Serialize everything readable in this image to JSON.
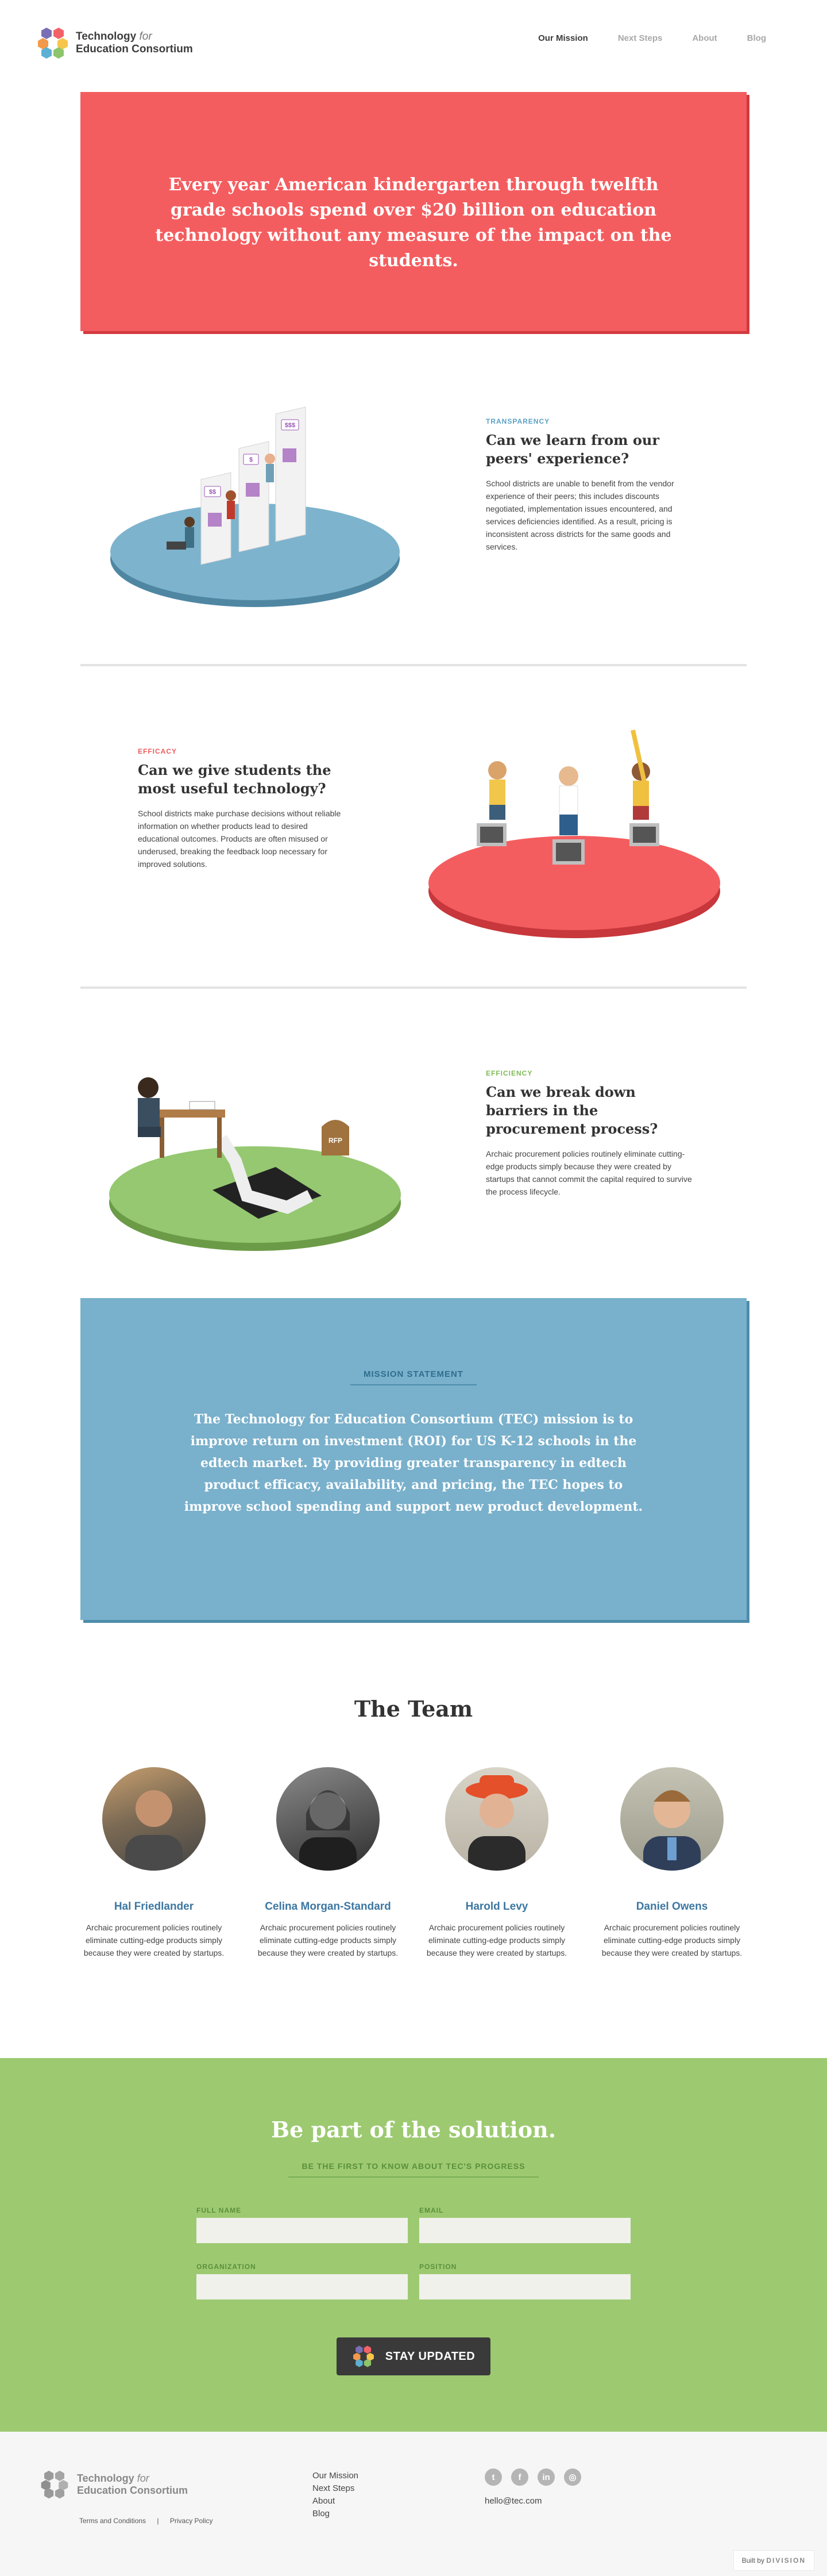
{
  "header": {
    "logo_line1_bold": "Technology",
    "logo_line1_italic": "for",
    "logo_line2": "Education Consortium",
    "nav": [
      "Our Mission",
      "Next Steps",
      "About",
      "Blog"
    ],
    "nav_active": "Our Mission"
  },
  "hero": {
    "text": "Every year American kindergarten through twelfth grade schools spend over $20 billion on education technology without any measure of the impact on the students."
  },
  "features": [
    {
      "kicker": "TRANSPARENCY",
      "kicker_color": "#5aa0c4",
      "title": "Can we learn from our peers' experience?",
      "body": "School districts are unable to benefit from the vendor experience of their peers; this includes discounts negotiated, implementation issues encountered, and services deficiencies identified. As a result, pricing is inconsistent across districts for the same goods and services."
    },
    {
      "kicker": "EFFICACY",
      "kicker_color": "#f05a5c",
      "title": "Can we give students the most useful technology?",
      "body": "School districts make purchase decisions without reliable information on whether products lead to desired educational outcomes. Products are often misused or underused, breaking the feedback loop necessary for improved solutions."
    },
    {
      "kicker": "EFFICIENCY",
      "kicker_color": "#7dbb54",
      "title": "Can we break down barriers in the procurement process?",
      "body": "Archaic procurement policies routinely eliminate cutting-edge products simply because they were created by startups that cannot commit the capital required to survive the process lifecycle."
    }
  ],
  "illustration_labels": {
    "price_1": "$$",
    "price_2": "$",
    "price_3": "$$$",
    "rfp": "RFP"
  },
  "mission": {
    "label": "MISSION STATEMENT",
    "text": "The Technology for Education Consortium (TEC) mission is to improve return on investment (ROI) for US K-12 schools in the edtech market. By providing greater transparency in edtech product efficacy, availability, and pricing, the TEC hopes to improve school spending and support new product development."
  },
  "team": {
    "title": "The Team",
    "members": [
      {
        "name": "Hal Friedlander",
        "bio": "Archaic procurement policies routinely eliminate cutting-edge products simply because they were created by startups."
      },
      {
        "name": "Celina Morgan-Standard",
        "bio": "Archaic procurement policies routinely eliminate cutting-edge products simply because they were created by startups."
      },
      {
        "name": "Harold Levy",
        "bio": "Archaic procurement policies routinely eliminate cutting-edge products simply because they were created by startups."
      },
      {
        "name": "Daniel Owens",
        "bio": "Archaic procurement policies routinely eliminate cutting-edge products simply because they were created by startups."
      }
    ]
  },
  "cta": {
    "title": "Be part of the solution.",
    "subtitle": "BE THE FIRST TO KNOW ABOUT TEC'S PROGRESS",
    "fields": {
      "full_name": "FULL NAME",
      "email": "EMAIL",
      "organization": "ORGANIZATION",
      "position": "POSITION"
    },
    "button": "STAY UPDATED"
  },
  "footer": {
    "logo_line1_bold": "Technology",
    "logo_line1_italic": "for",
    "logo_line2": "Education Consortium",
    "terms": "Terms and Conditions",
    "separator": "|",
    "privacy": "Privacy Policy",
    "nav": [
      "Our Mission",
      "Next Steps",
      "About",
      "Blog"
    ],
    "social_icons": [
      "twitter-icon",
      "facebook-icon",
      "linkedin-icon",
      "instagram-icon"
    ],
    "email": "hello@tec.com",
    "built_by": "Built by",
    "built_by_brand": "DIVISION"
  },
  "colors": {
    "hero_red": "#f45d5f",
    "mission_blue": "#79b0cb",
    "cta_green": "#9dca71",
    "name_blue": "#3c77a2"
  }
}
